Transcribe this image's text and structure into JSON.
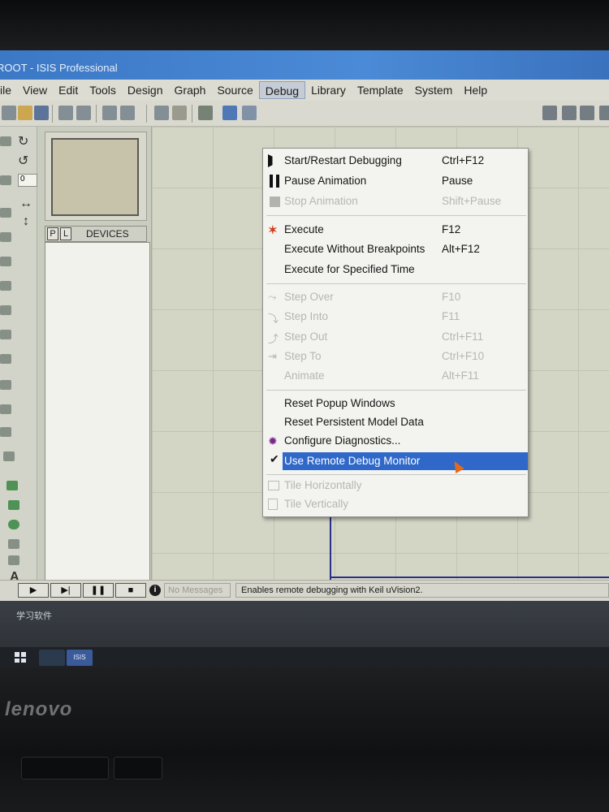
{
  "window": {
    "title": "ROOT - ISIS Professional"
  },
  "menubar": [
    {
      "label": "ile"
    },
    {
      "label": "View"
    },
    {
      "label": "Edit"
    },
    {
      "label": "Tools"
    },
    {
      "label": "Design"
    },
    {
      "label": "Graph"
    },
    {
      "label": "Source"
    },
    {
      "label": "Debug"
    },
    {
      "label": "Library"
    },
    {
      "label": "Template"
    },
    {
      "label": "System"
    },
    {
      "label": "Help"
    }
  ],
  "left_panel": {
    "pl_p": "P",
    "pl_l": "L",
    "devices_title": "DEVICES",
    "rotation_value": "0"
  },
  "debug_menu": {
    "items": [
      {
        "label": "Start/Restart Debugging",
        "shortcut": "Ctrl+F12",
        "icon": "start-debug-icon",
        "enabled": true
      },
      {
        "label": "Pause Animation",
        "shortcut": "Pause",
        "icon": "pause-icon",
        "enabled": true
      },
      {
        "label": "Stop Animation",
        "shortcut": "Shift+Pause",
        "icon": "stop-icon",
        "enabled": false
      },
      {
        "label": "Execute",
        "shortcut": "F12",
        "icon": "execute-icon",
        "enabled": true
      },
      {
        "label": "Execute Without Breakpoints",
        "shortcut": "Alt+F12",
        "icon": "",
        "enabled": true
      },
      {
        "label": "Execute for Specified Time",
        "shortcut": "",
        "icon": "",
        "enabled": true
      },
      {
        "label": "Step Over",
        "shortcut": "F10",
        "icon": "step-over-icon",
        "enabled": false
      },
      {
        "label": "Step Into",
        "shortcut": "F11",
        "icon": "step-into-icon",
        "enabled": false
      },
      {
        "label": "Step Out",
        "shortcut": "Ctrl+F11",
        "icon": "step-out-icon",
        "enabled": false
      },
      {
        "label": "Step To",
        "shortcut": "Ctrl+F10",
        "icon": "step-to-icon",
        "enabled": false
      },
      {
        "label": "Animate",
        "shortcut": "Alt+F11",
        "icon": "",
        "enabled": false
      },
      {
        "label": "Reset Popup Windows",
        "shortcut": "",
        "icon": "",
        "enabled": true
      },
      {
        "label": "Reset Persistent Model Data",
        "shortcut": "",
        "icon": "",
        "enabled": true
      },
      {
        "label": "Configure Diagnostics...",
        "shortcut": "",
        "icon": "bug-icon",
        "enabled": true
      },
      {
        "label": "Use Remote Debug Monitor",
        "shortcut": "",
        "icon": "check-icon",
        "enabled": true,
        "checked": true,
        "highlighted": true
      },
      {
        "label": "Tile Horizontally",
        "shortcut": "",
        "icon": "tile-horizontal-icon",
        "enabled": false
      },
      {
        "label": "Tile Vertically",
        "shortcut": "",
        "icon": "tile-vertical-icon",
        "enabled": false
      }
    ]
  },
  "statusbar": {
    "messages": "No Messages",
    "hint": "Enables remote debugging with Keil uVision2."
  },
  "simulation_controls": [
    {
      "icon": "play-icon",
      "glyph": "▶"
    },
    {
      "icon": "step-icon",
      "glyph": "▶|"
    },
    {
      "icon": "pause-icon",
      "glyph": "❚❚"
    },
    {
      "icon": "stop-icon",
      "glyph": "■"
    }
  ],
  "desktop": {
    "label": "学习软件"
  },
  "taskbar": {
    "isis_label": "ISIS"
  },
  "laptop": {
    "brand": "lenovo"
  },
  "colors": {
    "title_bar": "#3b78c6",
    "highlight": "#2f68c8",
    "canvas": "#d3d6c4",
    "sheet_border": "#2a2f8c"
  }
}
